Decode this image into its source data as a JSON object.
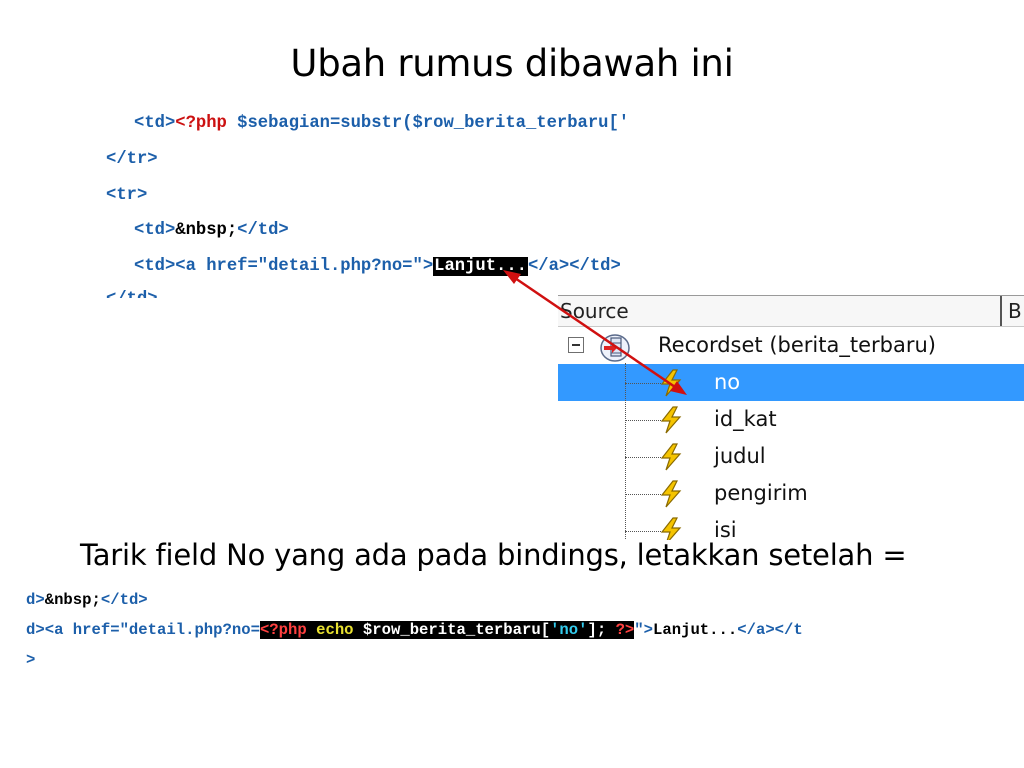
{
  "slide": {
    "title": "Ubah rumus dibawah ini",
    "instruction": "Tarik field No yang ada pada bindings, letakkan setelah ="
  },
  "top_code": {
    "line1": {
      "tag_open": "<td>",
      "php_open": "<?php",
      "code": " $sebagian=substr($row_berita_terbaru['"
    },
    "line2": "</tr>",
    "line3": "<tr>",
    "line4": {
      "tag_open": "<td>",
      "text": "&nbsp;",
      "tag_close": "</td>"
    },
    "line5": {
      "tag_open": "<td><a href=",
      "href": "\"detail.php?no=\"",
      "gt": ">",
      "link_text": "Lanjut...",
      "tag_close": "</a></td>"
    },
    "line6": "</td>"
  },
  "bindings_panel": {
    "header_source": "Source",
    "header_col2": "B",
    "recordset": "Recordset (berita_terbaru)",
    "fields": [
      "no",
      "id_kat",
      "judul",
      "pengirim",
      "isi"
    ],
    "selected_field": "no"
  },
  "bottom_code": {
    "line1": {
      "prefix": "d>",
      "text": "&nbsp;",
      "tag_close": "</td>"
    },
    "line2": {
      "prefix": "d><a href=",
      "href_start": "\"detail.php?no=",
      "php_open": "<?php",
      "echo": " echo ",
      "var": "$row_berita_terbaru[",
      "key": "'no'",
      "end": "]; ",
      "php_close": "?>",
      "href_end": "\">",
      "link_text": "Lanjut...",
      "tag_close": "</a></t"
    },
    "line3": ">"
  },
  "colors": {
    "tag_blue": "#1c5faa",
    "php_red": "#cc1111",
    "selection_blue": "#3399ff",
    "arrow_red": "#d01010"
  }
}
